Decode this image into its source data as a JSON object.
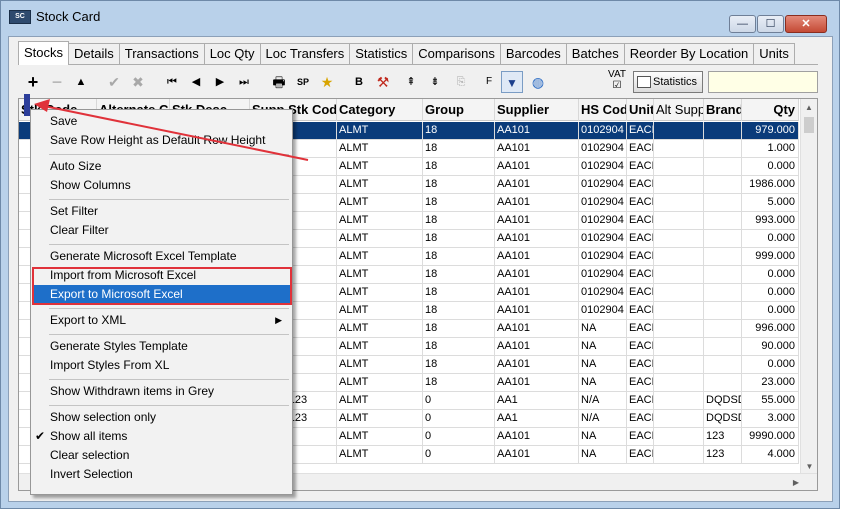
{
  "window": {
    "app_icon": "stock-app-icon",
    "title": "Stock Card",
    "buttons": {
      "minimize": "—",
      "maximize": "☐",
      "close": "✕"
    }
  },
  "tabs": [
    "Stocks",
    "Details",
    "Transactions",
    "Loc Qty",
    "Loc Transfers",
    "Statistics",
    "Comparisons",
    "Barcodes",
    "Batches",
    "Reorder By Location",
    "Units"
  ],
  "toolbar": {
    "vat_label": "VAT",
    "vat_checked": "☑",
    "statistics_label": "Statistics",
    "search_value": "",
    "sp_label": "SP",
    "f_label": "F"
  },
  "grid": {
    "columns": [
      "Stk Code",
      "Alternate Code",
      "Stk Desc",
      "Supp Stk Code",
      "Category",
      "Group",
      "Supplier",
      "HS Code",
      "Unit",
      "Alt Supplier",
      "Brand",
      "Qty"
    ],
    "rows": [
      [
        "",
        "",
        "",
        "",
        "ALMT",
        "18",
        "AA101",
        "0102904",
        "EACH",
        "",
        "",
        "979.000"
      ],
      [
        "",
        "",
        "",
        "",
        "ALMT",
        "18",
        "AA101",
        "0102904",
        "EACH",
        "",
        "",
        "1.000"
      ],
      [
        "",
        "",
        "",
        "",
        "ALMT",
        "18",
        "AA101",
        "0102904",
        "EACH",
        "",
        "",
        "0.000"
      ],
      [
        "",
        "",
        "",
        "",
        "ALMT",
        "18",
        "AA101",
        "0102904",
        "EACH",
        "",
        "",
        "1986.000"
      ],
      [
        "",
        "",
        "",
        "",
        "ALMT",
        "18",
        "AA101",
        "0102904",
        "EACH",
        "",
        "",
        "5.000"
      ],
      [
        "",
        "",
        "",
        "",
        "ALMT",
        "18",
        "AA101",
        "0102904",
        "EACH",
        "",
        "",
        "993.000"
      ],
      [
        "",
        "",
        "",
        "",
        "ALMT",
        "18",
        "AA101",
        "0102904",
        "EACH",
        "",
        "",
        "0.000"
      ],
      [
        "",
        "",
        "",
        "",
        "ALMT",
        "18",
        "AA101",
        "0102904",
        "EACH",
        "",
        "",
        "999.000"
      ],
      [
        "",
        "",
        "",
        "",
        "ALMT",
        "18",
        "AA101",
        "0102904",
        "EACH",
        "",
        "",
        "0.000"
      ],
      [
        "",
        "",
        "",
        "",
        "ALMT",
        "18",
        "AA101",
        "0102904",
        "EACH",
        "",
        "",
        "0.000"
      ],
      [
        "",
        "",
        "",
        "",
        "ALMT",
        "18",
        "AA101",
        "0102904",
        "EACH",
        "",
        "",
        "0.000"
      ],
      [
        "",
        "",
        "",
        "",
        "ALMT",
        "18",
        "AA101",
        "NA",
        "EACH",
        "",
        "",
        "996.000"
      ],
      [
        "",
        "",
        "",
        "",
        "ALMT",
        "18",
        "AA101",
        "NA",
        "EACH",
        "",
        "",
        "90.000"
      ],
      [
        "",
        "",
        "",
        "",
        "ALMT",
        "18",
        "AA101",
        "NA",
        "EACH",
        "",
        "",
        "0.000"
      ],
      [
        "",
        "",
        "",
        "",
        "ALMT",
        "18",
        "AA101",
        "NA",
        "EACH",
        "",
        "",
        "23.000"
      ],
      [
        "",
        "",
        "",
        "567890123",
        "ALMT",
        "0",
        "AA1",
        "N/A",
        "EACH",
        "",
        "DQDSD",
        "55.000"
      ],
      [
        "",
        "",
        "",
        "567890123",
        "ALMT",
        "0",
        "AA1",
        "N/A",
        "EACH",
        "",
        "DQDSD",
        "3.000"
      ],
      [
        "",
        "",
        "",
        "",
        "ALMT",
        "0",
        "AA101",
        "NA",
        "EACH",
        "",
        "123",
        "9990.000"
      ],
      [
        "",
        "",
        "",
        "",
        "ALMT",
        "0",
        "AA101",
        "NA",
        "EACH",
        "",
        "123",
        "4.000"
      ]
    ]
  },
  "context_menu": {
    "items": [
      {
        "label": "Save"
      },
      {
        "label": "Save Row Height as Default Row Height"
      },
      {
        "label": "Auto Size"
      },
      {
        "label": "Show Columns"
      },
      {
        "label": "Set Filter"
      },
      {
        "label": "Clear Filter"
      },
      {
        "label": "Generate Microsoft Excel Template"
      },
      {
        "label": "Import from Microsoft Excel"
      },
      {
        "label": "Export to Microsoft Excel"
      },
      {
        "label": "Export to XML"
      },
      {
        "label": "Generate Styles Template"
      },
      {
        "label": "Import Styles From XL"
      },
      {
        "label": "Show Withdrawn items in Grey"
      },
      {
        "label": "Show selection only"
      },
      {
        "label": "Show all items"
      },
      {
        "label": "Clear selection"
      },
      {
        "label": "Invert Selection"
      }
    ],
    "hovered": "Export to Microsoft Excel",
    "checked": "Show all items",
    "submenu": "Export to XML"
  },
  "colors": {
    "selection": "#0a3b7a",
    "menu_hover": "#1e6fc9",
    "annotation": "#e0323a"
  }
}
